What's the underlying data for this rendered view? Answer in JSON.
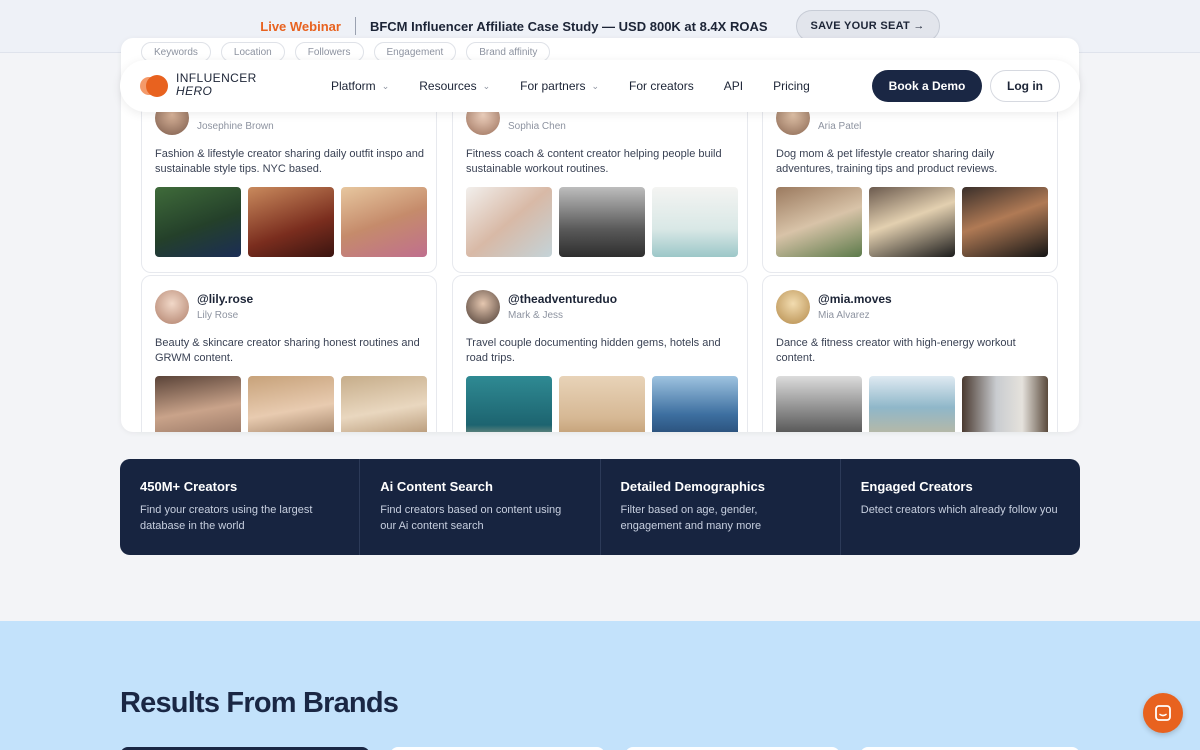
{
  "announcement": {
    "live_label": "Live Webinar",
    "title": "BFCM Influencer Affiliate Case Study — USD 800K at 8.4X ROAS",
    "cta_label": "SAVE YOUR SEAT →"
  },
  "filters": [
    "Keywords",
    "Location",
    "Followers",
    "Engagement",
    "Brand affinity"
  ],
  "creators": [
    {
      "handle": "",
      "name": "Josephine Brown",
      "bio": "Fashion & lifestyle creator sharing daily outfit inspo and sustainable style tips. NYC based."
    },
    {
      "handle": "",
      "name": "Sophia Chen",
      "bio": "Fitness coach & content creator helping people build sustainable workout routines."
    },
    {
      "handle": "",
      "name": "Aria Patel",
      "bio": "Dog mom & pet lifestyle creator sharing daily adventures, training tips and product reviews."
    },
    {
      "handle": "@lily.rose",
      "name": "Lily Rose",
      "bio": "Beauty & skincare creator sharing honest routines and GRWM content."
    },
    {
      "handle": "@theadventureduo",
      "name": "Mark & Jess",
      "bio": "Travel couple documenting hidden gems, hotels and road trips."
    },
    {
      "handle": "@mia.moves",
      "name": "Mia Alvarez",
      "bio": "Dance & fitness creator with high-energy workout content."
    }
  ],
  "nav": {
    "logo_line1": "INFLUENCER",
    "logo_line2": "HERO",
    "items": [
      {
        "label": "Platform",
        "dropdown": true
      },
      {
        "label": "Resources",
        "dropdown": true
      },
      {
        "label": "For partners",
        "dropdown": true
      },
      {
        "label": "For creators",
        "dropdown": false
      },
      {
        "label": "API",
        "dropdown": false
      },
      {
        "label": "Pricing",
        "dropdown": false
      }
    ],
    "demo_label": "Book a Demo",
    "login_label": "Log in"
  },
  "features": [
    {
      "title": "450M+ Creators",
      "desc": "Find your creators using the largest database in the world"
    },
    {
      "title": "Ai Content Search",
      "desc": "Find creators based on content using our Ai content search"
    },
    {
      "title": "Detailed Demographics",
      "desc": "Filter based on age, gender, engagement and many more"
    },
    {
      "title": "Engaged Creators",
      "desc": "Detect creators which already follow you"
    }
  ],
  "results": {
    "heading": "Results From Brands"
  },
  "colors": {
    "accent": "#e8621f",
    "navy": "#1a2744",
    "results_bg": "#c3e2fb"
  },
  "icons": {
    "chat": "chat-icon",
    "chevron": "chevron-down-icon"
  }
}
